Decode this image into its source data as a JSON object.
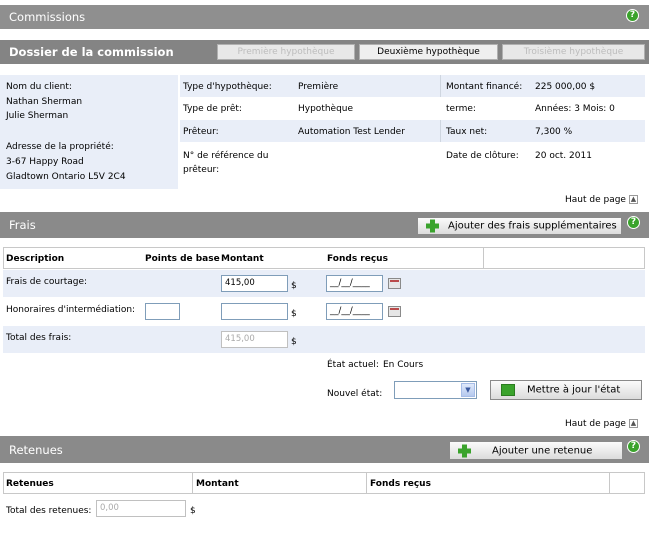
{
  "commissions": {
    "title": "Commissions"
  },
  "dossier": {
    "title": "Dossier de la commission",
    "tabs": [
      {
        "label": "Première hypothèque",
        "enabled": false
      },
      {
        "label": "Deuxième hypothèque",
        "enabled": true
      },
      {
        "label": "Troisième hypothèque",
        "enabled": false
      }
    ],
    "client_label": "Nom du client:",
    "client_names": [
      "Nathan Sherman",
      "Julie Sherman"
    ],
    "address_label": "Adresse de la propriété:",
    "address_lines": [
      "3-67 Happy Road",
      "Gladtown Ontario L5V 2C4"
    ],
    "fields": {
      "type_hypotheque_label": "Type d'hypothèque:",
      "type_hypotheque_value": "Première",
      "type_pret_label": "Type de prêt:",
      "type_pret_value": "Hypothèque",
      "preteur_label": "Prêteur:",
      "preteur_value": "Automation Test Lender",
      "ref_label_line1": "N° de référence du",
      "ref_label_line2": "prêteur:",
      "montant_label": "Montant financé:",
      "montant_value": "225 000,00 $",
      "terme_label": "terme:",
      "terme_value": "Années: 3 Mois: 0",
      "taux_label": "Taux net:",
      "taux_value": "7,300 %",
      "cloture_label": "Date de clôture:",
      "cloture_value": "20 oct. 2011"
    }
  },
  "haut_de_page": "Haut de page",
  "frais": {
    "title": "Frais",
    "add_button": "Ajouter des frais supplémentaires",
    "headers": {
      "description": "Description",
      "points": "Points de base",
      "montant": "Montant",
      "fonds": "Fonds reçus"
    },
    "rows": [
      {
        "label": "Frais de courtage:",
        "montant": "415,00",
        "date": "__/__/____"
      },
      {
        "label": "Honoraires d'intermédiation:",
        "montant": "",
        "date": "__/__/____"
      }
    ],
    "total_label": "Total des frais:",
    "total_value": "415,00",
    "currency": "$",
    "etat_actuel_label": "État actuel:",
    "etat_actuel_value": "En Cours",
    "nouvel_etat_label": "Nouvel état:",
    "update_button": "Mettre à jour l'état"
  },
  "retenues": {
    "title": "Retenues",
    "add_button": "Ajouter une retenue",
    "headers": {
      "retenues": "Retenues",
      "montant": "Montant",
      "fonds": "Fonds reçus"
    },
    "total_label": "Total des retenues:",
    "total_value": "0,00",
    "currency": "$"
  },
  "colors": {
    "header_bar": "#8a8a8a",
    "info_panel": "#e9eef8",
    "accent_green": "#3aa32c"
  },
  "icons": {
    "help": "help-icon",
    "plus": "plus-icon",
    "calendar": "calendar-icon",
    "top": "arrow-up-icon",
    "dropdown": "chevron-down-icon",
    "update": "refresh-icon"
  }
}
